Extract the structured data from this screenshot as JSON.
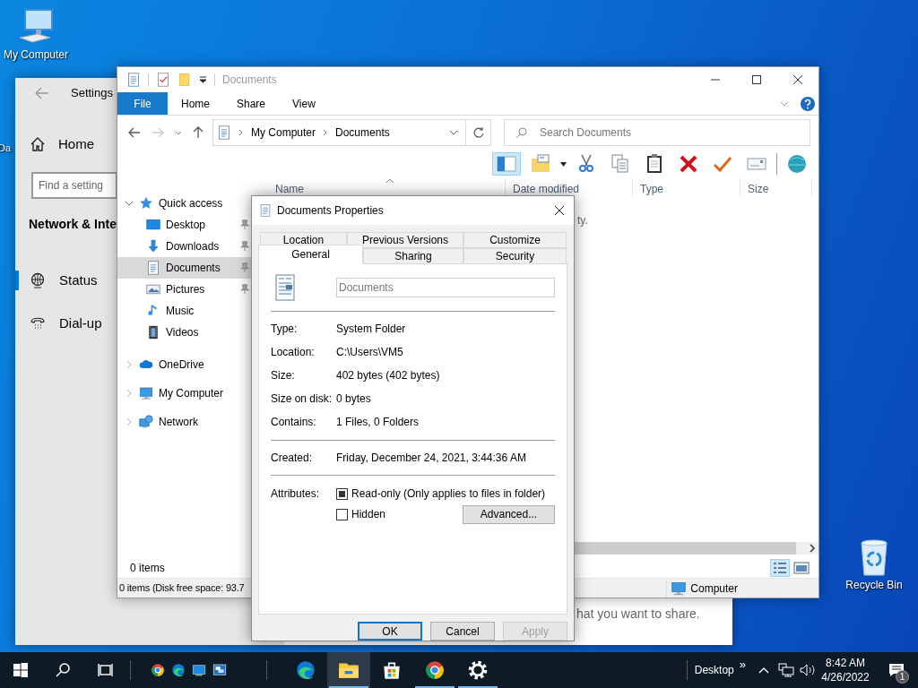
{
  "desktop": {
    "icons": [
      {
        "label": "My Computer",
        "kind": "computer"
      },
      {
        "label": "Da",
        "kind": "partial"
      },
      {
        "label": "Recycle Bin",
        "kind": "recycle"
      }
    ]
  },
  "settings": {
    "title": "Settings",
    "home": "Home",
    "search": {
      "placeholder": "Find a setting"
    },
    "section": "Network & Inte",
    "items": [
      {
        "label": "Status",
        "kind": "status",
        "selected": true
      },
      {
        "label": "Dial-up",
        "kind": "dialup",
        "selected": false
      }
    ],
    "content_text": "hat you want to share."
  },
  "explorer": {
    "title": "Documents",
    "ribbon_tabs": [
      {
        "label": "File",
        "kind": "file"
      },
      {
        "label": "Home",
        "kind": "tab"
      },
      {
        "label": "Share",
        "kind": "tab"
      },
      {
        "label": "View",
        "kind": "tab"
      }
    ],
    "address": [
      "My Computer",
      "Documents"
    ],
    "search": {
      "placeholder": "Search Documents"
    },
    "preview_pane_on": true,
    "columns": [
      {
        "label": "Name",
        "sorted": true
      },
      {
        "label": "Date modified",
        "sorted": false
      },
      {
        "label": "Type",
        "sorted": false
      },
      {
        "label": "Size",
        "sorted": false
      }
    ],
    "empty_message": "ty.",
    "nav": [
      {
        "label": "Quick access",
        "kind": "quick",
        "expanded": true,
        "selected": false,
        "children": [
          {
            "label": "Desktop",
            "kind": "desktop",
            "pinned": true,
            "selected": false
          },
          {
            "label": "Downloads",
            "kind": "downloads",
            "pinned": true,
            "selected": false
          },
          {
            "label": "Documents",
            "kind": "documents",
            "pinned": true,
            "selected": true
          },
          {
            "label": "Pictures",
            "kind": "pictures",
            "pinned": true,
            "selected": false
          },
          {
            "label": "Music",
            "kind": "music",
            "pinned": false,
            "selected": false
          },
          {
            "label": "Videos",
            "kind": "videos",
            "pinned": false,
            "selected": false
          }
        ]
      },
      {
        "label": "OneDrive",
        "kind": "cloud",
        "expanded": false,
        "selected": false
      },
      {
        "label": "My Computer",
        "kind": "computer",
        "expanded": false,
        "selected": false
      },
      {
        "label": "Network",
        "kind": "network",
        "expanded": false,
        "selected": false
      }
    ],
    "item_count": "0 items",
    "views": [
      {
        "kind": "details",
        "selected": true
      },
      {
        "kind": "thumbnails",
        "selected": false
      }
    ],
    "status_bar": {
      "text": "0 items (Disk free space: 93.7",
      "zone": "Computer"
    }
  },
  "dialog": {
    "title": "Documents Properties",
    "tab_rows": [
      {
        "tabs": [
          {
            "label": "Location",
            "selected": false
          },
          {
            "label": "Previous Versions",
            "selected": false
          },
          {
            "label": "Customize",
            "selected": false
          }
        ]
      },
      {
        "tabs": [
          {
            "label": "General",
            "selected": true
          },
          {
            "label": "Sharing",
            "selected": false
          },
          {
            "label": "Security",
            "selected": false
          }
        ]
      }
    ],
    "name": "Documents",
    "details": [
      {
        "label": "Type:",
        "value": "System Folder"
      },
      {
        "label": "Location:",
        "value": "C:\\Users\\VM5"
      },
      {
        "label": "Size:",
        "value": "402 bytes (402 bytes)"
      },
      {
        "label": "Size on disk:",
        "value": "0 bytes"
      },
      {
        "label": "Contains:",
        "value": "1 Files, 0 Folders"
      }
    ],
    "created": {
      "label": "Created:",
      "value": "Friday, December 24, 2021, 3:44:36 AM"
    },
    "attributes": {
      "label": "Attributes:",
      "options": [
        {
          "label": "Read-only (Only applies to files in folder)",
          "checked": false,
          "indeterminate": true
        },
        {
          "label": "Hidden",
          "checked": false,
          "indeterminate": false
        }
      ],
      "advanced": "Advanced..."
    },
    "buttons": [
      {
        "label": "OK",
        "default": true,
        "disabled": false
      },
      {
        "label": "Cancel",
        "default": false,
        "disabled": false
      },
      {
        "label": "Apply",
        "default": false,
        "disabled": true
      }
    ]
  },
  "taskbar": {
    "quick_launch": [
      {
        "kind": "chrome"
      },
      {
        "kind": "edge"
      },
      {
        "kind": "desktop"
      },
      {
        "kind": "remote"
      }
    ],
    "apps": [
      {
        "kind": "edge",
        "running": false,
        "active": false
      },
      {
        "kind": "explorer",
        "running": true,
        "active": true
      },
      {
        "kind": "store",
        "running": false,
        "active": false
      },
      {
        "kind": "chrome",
        "running": true,
        "active": false
      },
      {
        "kind": "settings",
        "running": true,
        "active": false
      }
    ],
    "toolbar_label": "Desktop",
    "overflow": "»",
    "time": "8:42 AM",
    "date": "4/26/2022",
    "notification_count": "1"
  }
}
